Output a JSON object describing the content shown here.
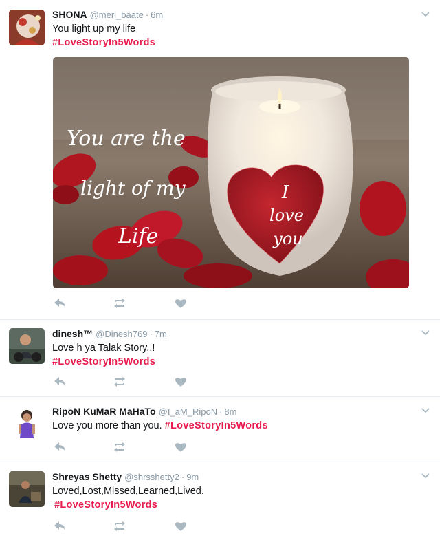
{
  "tweets": [
    {
      "name": "SHONA",
      "handle": "@meri_baate",
      "time": "6m",
      "text": "You light up my life",
      "hashtag": "#LoveStoryIn5Words",
      "media": {
        "overlay_left": [
          "You are the",
          "light of my",
          "Life"
        ],
        "overlay_heart": [
          "I",
          "love",
          "you"
        ]
      }
    },
    {
      "name": "dinesh™",
      "handle": "@Dinesh769",
      "time": "7m",
      "text": "Love h ya Talak Story..!",
      "hashtag": "#LoveStoryIn5Words"
    },
    {
      "name": "RipoN KuMaR MaHaTo",
      "handle": "@I_aM_RipoN",
      "time": "8m",
      "text": "Love you more than you.",
      "hashtag": "#LoveStoryIn5Words"
    },
    {
      "name": "Shreyas Shetty",
      "handle": "@shrsshetty2",
      "time": "9m",
      "text": "Loved,Lost,Missed,Learned,Lived.",
      "hashtag": "#LoveStoryIn5Words"
    }
  ],
  "separator": "·",
  "icons": {
    "reply": "reply-icon",
    "retweet": "retweet-icon",
    "like": "heart-icon",
    "menu": "chevron-down-icon"
  },
  "colors": {
    "hashtag": "#e81c4f",
    "muted": "#8899a6",
    "icon": "#aab8c2",
    "border": "#e6ecf0"
  }
}
